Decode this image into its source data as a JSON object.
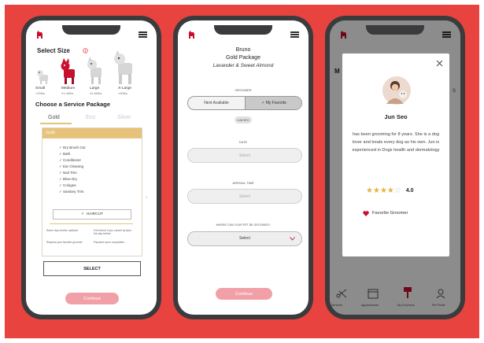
{
  "colors": {
    "background_red": "#e8433f",
    "brand_red": "#c8102e",
    "phone_frame": "#3b3b3e",
    "gold": "#e6c27a",
    "button_pink": "#f2a0a8"
  },
  "screen1": {
    "title": "Select Size",
    "sizes": [
      {
        "label": "Small",
        "range": "<20lbs"
      },
      {
        "label": "Medium",
        "range": "21-40lbs"
      },
      {
        "label": "Large",
        "range": "41-60lbs"
      },
      {
        "label": "X-Large",
        "range": ">60lbs"
      }
    ],
    "package_title": "Choose a Service Package",
    "tabs": [
      "Gold",
      "Eco",
      "Silver"
    ],
    "card_header": "Gold",
    "services": [
      "Dry Brush Out",
      "Bath",
      "Conditioner",
      "Ear Cleaning",
      "Nail Trim",
      "Blow Dry",
      "Cologne",
      "Sanitary Trim"
    ],
    "addon": "HAIRCUT",
    "notes": [
      "Same day service optional",
      "Full refund if you cancel by 6pm the day before",
      "Request your favorite groomer",
      "Payment upon completion"
    ],
    "select_button": "SELECT",
    "continue_button": "Continue"
  },
  "screen2": {
    "dog_name": "Bruno",
    "package": "Gold Package",
    "scent": "Lavander & Sweet Almond",
    "groomer_label": "GROOMER",
    "groomer_options": [
      "Next Available",
      "My Favorite"
    ],
    "groomer_chip": "JUN SEO",
    "date_label": "DATE",
    "date_placeholder": "Select",
    "arrival_label": "ARRIVAL TIME",
    "arrival_placeholder": "Select",
    "location_label": "WHERE CAN YOUR PET BE GROOMED?",
    "location_placeholder": "Select",
    "continue_button": "Continue"
  },
  "screen3": {
    "peek_letter": "M",
    "peek_right": "s",
    "groomer_name": "Jun Seo",
    "bio": "has been grooming for 8 years. She is a dog lover and treats every dog as his own. Jun is experienced in Dogs health and dermatology",
    "rating": "4.0",
    "rating_value": 4.0,
    "favorite_label": "Favorite Groomer",
    "nav": [
      "Services",
      "Appointments",
      "My Groomers",
      "Pet Profile"
    ]
  }
}
